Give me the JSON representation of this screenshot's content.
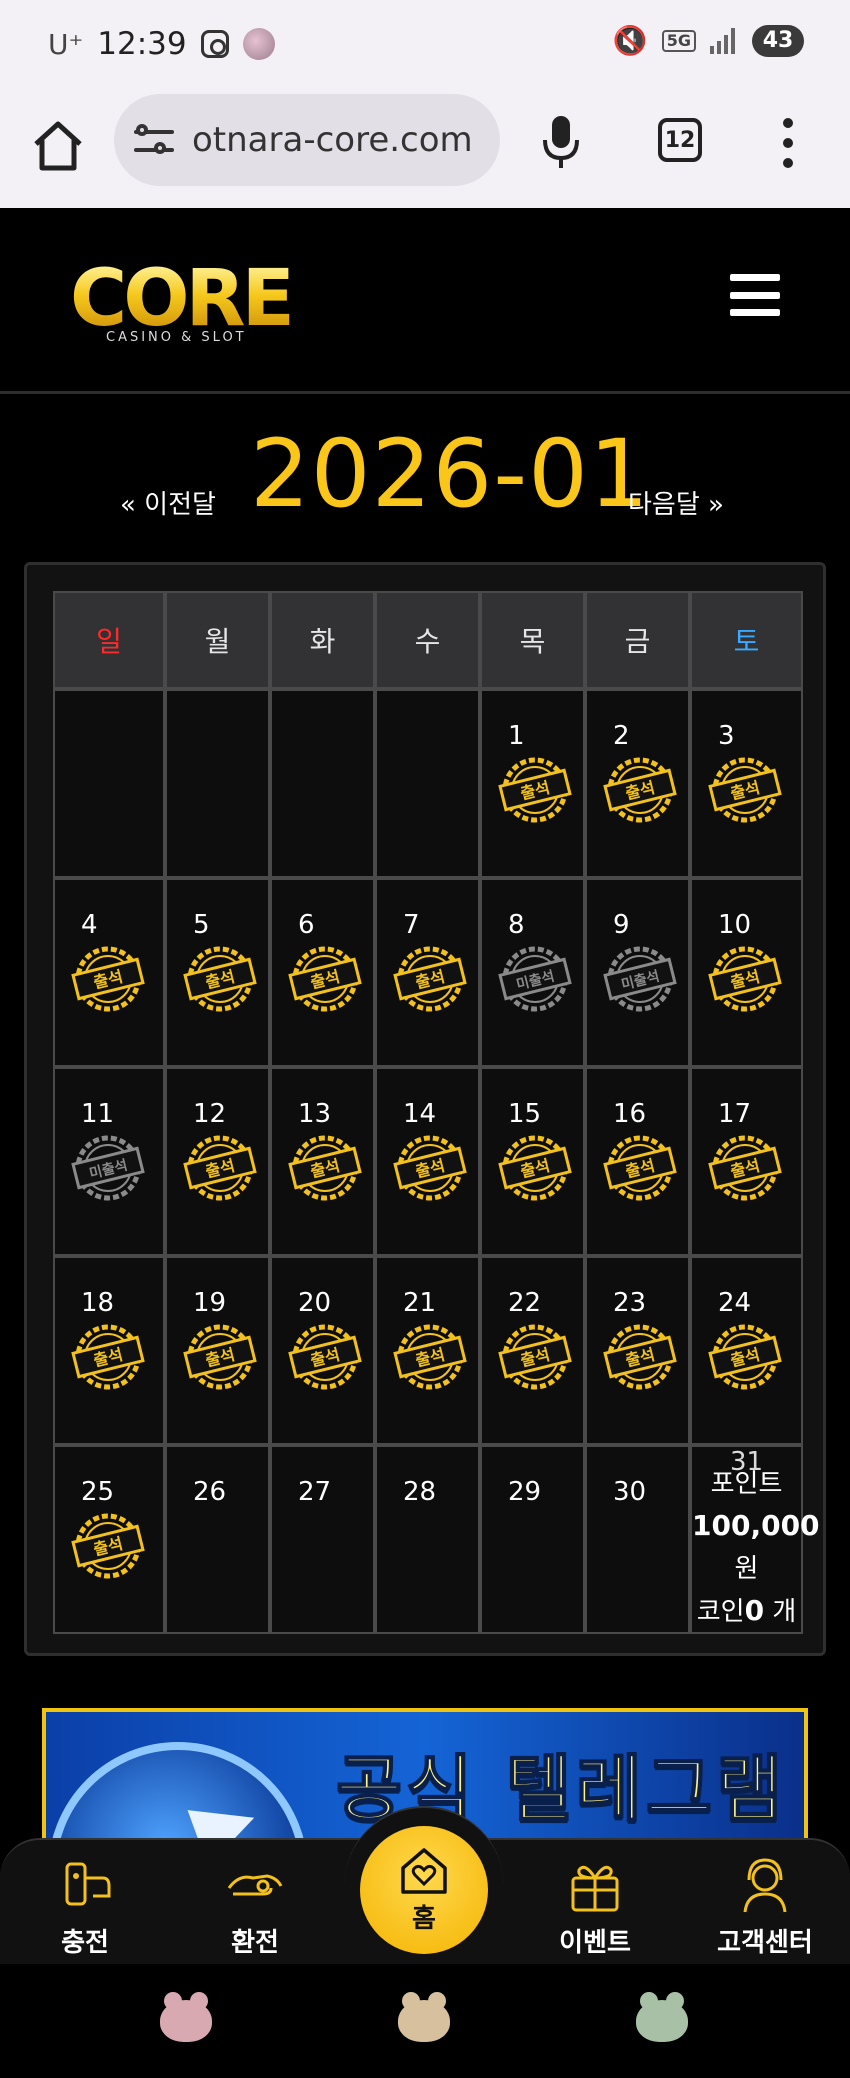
{
  "status_bar": {
    "carrier": "U⁺",
    "time": "12:39",
    "network": "5G",
    "battery": "43"
  },
  "browser": {
    "url": "otnara-core.com",
    "tab_count": "12"
  },
  "logo": {
    "word": "CORE",
    "subtitle": "CASINO & SLOT"
  },
  "calendar_nav": {
    "prev_label": "« 이전달",
    "month": "2026-01",
    "next_label": "다음달 »"
  },
  "weekdays": [
    {
      "label": "일",
      "color": "#ff2a2a"
    },
    {
      "label": "월",
      "color": "#e6e6e6"
    },
    {
      "label": "화",
      "color": "#e6e6e6"
    },
    {
      "label": "수",
      "color": "#e6e6e6"
    },
    {
      "label": "목",
      "color": "#e6e6e6"
    },
    {
      "label": "금",
      "color": "#e6e6e6"
    },
    {
      "label": "토",
      "color": "#3aa9ff"
    }
  ],
  "stamps": {
    "attended": "출석",
    "missed": "미출석"
  },
  "days": [
    {
      "d": "",
      "s": ""
    },
    {
      "d": "",
      "s": ""
    },
    {
      "d": "",
      "s": ""
    },
    {
      "d": "",
      "s": ""
    },
    {
      "d": "1",
      "s": "attended"
    },
    {
      "d": "2",
      "s": "attended"
    },
    {
      "d": "3",
      "s": "attended"
    },
    {
      "d": "4",
      "s": "attended"
    },
    {
      "d": "5",
      "s": "attended"
    },
    {
      "d": "6",
      "s": "attended"
    },
    {
      "d": "7",
      "s": "attended"
    },
    {
      "d": "8",
      "s": "missed"
    },
    {
      "d": "9",
      "s": "missed"
    },
    {
      "d": "10",
      "s": "attended"
    },
    {
      "d": "11",
      "s": "missed"
    },
    {
      "d": "12",
      "s": "attended"
    },
    {
      "d": "13",
      "s": "attended"
    },
    {
      "d": "14",
      "s": "attended"
    },
    {
      "d": "15",
      "s": "attended"
    },
    {
      "d": "16",
      "s": "attended"
    },
    {
      "d": "17",
      "s": "attended"
    },
    {
      "d": "18",
      "s": "attended"
    },
    {
      "d": "19",
      "s": "attended"
    },
    {
      "d": "20",
      "s": "attended"
    },
    {
      "d": "21",
      "s": "attended"
    },
    {
      "d": "22",
      "s": "attended"
    },
    {
      "d": "23",
      "s": "attended"
    },
    {
      "d": "24",
      "s": "attended"
    },
    {
      "d": "25",
      "s": "attended"
    },
    {
      "d": "26",
      "s": ""
    },
    {
      "d": "27",
      "s": ""
    },
    {
      "d": "28",
      "s": ""
    },
    {
      "d": "29",
      "s": ""
    },
    {
      "d": "30",
      "s": ""
    },
    {
      "d": "31",
      "s": "points"
    }
  ],
  "points_cell": {
    "line1": "포인트",
    "amount": "100,000",
    "line3": "원",
    "coin_prefix": "코인",
    "coin_value": "0",
    "coin_suffix": " 개"
  },
  "banner": {
    "text": "공식 텔레그램"
  },
  "bottom_nav": {
    "charge": "충전",
    "exchange": "환전",
    "home": "홈",
    "event": "이벤트",
    "support": "고객센터"
  },
  "colors": {
    "accent": "#f9c619",
    "stamp_gold": "#f2c11d",
    "stamp_gray": "#8a8a8a"
  }
}
